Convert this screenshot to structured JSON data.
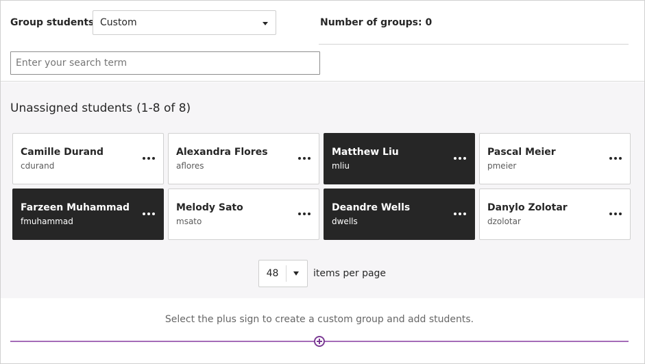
{
  "header": {
    "group_label": "Group students",
    "group_select_value": "Custom",
    "number_of_groups": "Number of groups: 0",
    "search_placeholder": "Enter your search term"
  },
  "unassigned": {
    "title": "Unassigned students",
    "range": "(1-8 of 8)",
    "students": [
      {
        "name": "Camille Durand",
        "username": "cdurand",
        "selected": false
      },
      {
        "name": "Alexandra Flores",
        "username": "aflores",
        "selected": false
      },
      {
        "name": "Matthew Liu",
        "username": "mliu",
        "selected": true
      },
      {
        "name": "Pascal Meier",
        "username": "pmeier",
        "selected": false
      },
      {
        "name": "Farzeen Muhammad",
        "username": "fmuhammad",
        "selected": true
      },
      {
        "name": "Melody Sato",
        "username": "msato",
        "selected": false
      },
      {
        "name": "Deandre Wells",
        "username": "dwells",
        "selected": true
      },
      {
        "name": "Danylo Zolotar",
        "username": "dzolotar",
        "selected": false
      }
    ]
  },
  "pagination": {
    "items_per_page_value": "48",
    "items_per_page_label": "items per page"
  },
  "footer": {
    "hint": "Select the plus sign to create a custom group and add students."
  },
  "colors": {
    "selected_card": "#262626",
    "accent_line": "#a46bb8",
    "plus_icon": "#7b3b94"
  },
  "icons": {
    "more": "more-options-icon",
    "add": "add-group-plus-icon",
    "dropdown": "chevron-down-icon"
  }
}
